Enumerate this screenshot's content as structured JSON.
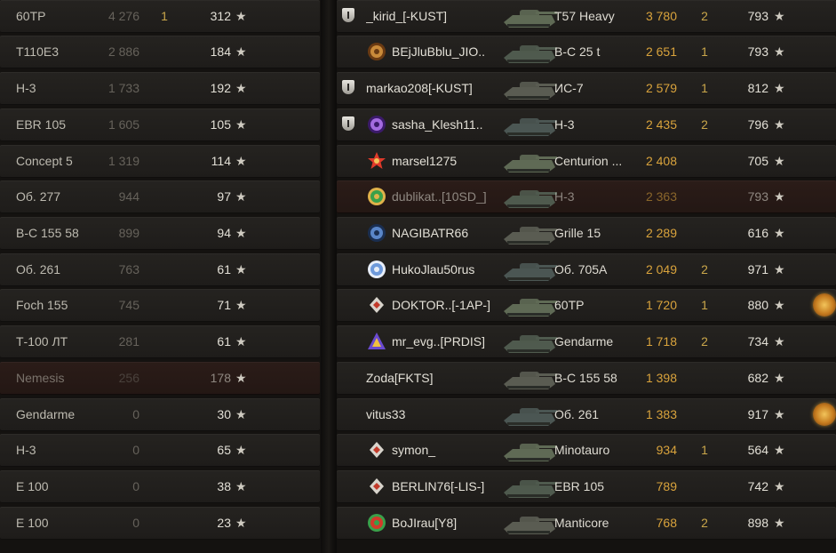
{
  "colors": {
    "gold": "#d9a33c",
    "kills": "#c9a64a",
    "dim": "#66625b",
    "text": "#e2dfd6",
    "dead_row": "#2b1c18"
  },
  "left_team": [
    {
      "tank": "60TP",
      "damage": "4 276",
      "kills": "1",
      "score": "312",
      "dead": false
    },
    {
      "tank": "T110E3",
      "damage": "2 886",
      "kills": "",
      "score": "184",
      "dead": false
    },
    {
      "tank": "Н-3",
      "damage": "1 733",
      "kills": "",
      "score": "192",
      "dead": false
    },
    {
      "tank": "EBR 105",
      "damage": "1 605",
      "kills": "",
      "score": "105",
      "dead": false
    },
    {
      "tank": "Concept 5",
      "damage": "1 319",
      "kills": "",
      "score": "114",
      "dead": false
    },
    {
      "tank": "Об. 277",
      "damage": "944",
      "kills": "",
      "score": "97",
      "dead": false
    },
    {
      "tank": "В-С 155 58",
      "damage": "899",
      "kills": "",
      "score": "94",
      "dead": false
    },
    {
      "tank": "Об. 261",
      "damage": "763",
      "kills": "",
      "score": "61",
      "dead": false
    },
    {
      "tank": "Foch 155",
      "damage": "745",
      "kills": "",
      "score": "71",
      "dead": false
    },
    {
      "tank": "Т-100 ЛТ",
      "damage": "281",
      "kills": "",
      "score": "61",
      "dead": false
    },
    {
      "tank": "Nemesis",
      "damage": "256",
      "kills": "",
      "score": "178",
      "dead": true
    },
    {
      "tank": "Gendarme",
      "damage": "0",
      "kills": "",
      "score": "30",
      "dead": false
    },
    {
      "tank": "Н-3",
      "damage": "0",
      "kills": "",
      "score": "65",
      "dead": false
    },
    {
      "tank": "E 100",
      "damage": "0",
      "kills": "",
      "score": "38",
      "dead": false
    },
    {
      "tank": "E 100",
      "damage": "0",
      "kills": "",
      "score": "23",
      "dead": false
    }
  ],
  "right_team": [
    {
      "name": "_kirid_[-KUST]",
      "badge": true,
      "icon": "",
      "tank": "T57 Heavy",
      "damage": "3 780",
      "kills": "2",
      "score": "793",
      "medal": false,
      "dead": false
    },
    {
      "name": "BEjJluBblu_JIO..",
      "badge": false,
      "icon": "bronze-rank-icon",
      "tank": "В-С 25 t",
      "damage": "2 651",
      "kills": "1",
      "score": "793",
      "medal": false,
      "dead": false
    },
    {
      "name": "markao208[-KUST]",
      "badge": true,
      "icon": "",
      "tank": "ИС-7",
      "damage": "2 579",
      "kills": "1",
      "score": "812",
      "medal": false,
      "dead": false
    },
    {
      "name": "sasha_Klesh11..",
      "badge": true,
      "icon": "purple-rank-icon",
      "tank": "Н-3",
      "damage": "2 435",
      "kills": "2",
      "score": "796",
      "medal": false,
      "dead": false
    },
    {
      "name": "marsel1275",
      "badge": false,
      "icon": "red-star-rank-icon",
      "tank": "Centurion ...",
      "damage": "2 408",
      "kills": "",
      "score": "705",
      "medal": false,
      "dead": false
    },
    {
      "name": "dublikat..[10SD_]",
      "badge": false,
      "icon": "green-rank-icon",
      "tank": "Н-3",
      "damage": "2 363",
      "kills": "",
      "score": "793",
      "medal": false,
      "dead": true
    },
    {
      "name": "NAGIBATR66",
      "badge": false,
      "icon": "blue-rank-icon",
      "tank": "Grille 15",
      "damage": "2 289",
      "kills": "",
      "score": "616",
      "medal": false,
      "dead": false
    },
    {
      "name": "HukoJlau50rus",
      "badge": false,
      "icon": "blue-round-rank-icon",
      "tank": "Об. 705А",
      "damage": "2 049",
      "kills": "2",
      "score": "971",
      "medal": false,
      "dead": false
    },
    {
      "name": "DOKTOR..[-1AP-]",
      "badge": false,
      "icon": "diamond-rank-icon",
      "tank": "60TP",
      "damage": "1 720",
      "kills": "1",
      "score": "880",
      "medal": true,
      "dead": false
    },
    {
      "name": "mr_evg..[PRDIS]",
      "badge": false,
      "icon": "purple-triangle-rank-icon",
      "tank": "Gendarme",
      "damage": "1 718",
      "kills": "2",
      "score": "734",
      "medal": false,
      "dead": false
    },
    {
      "name": "Zoda[FKTS]",
      "badge": false,
      "icon": "",
      "tank": "В-С 155 58",
      "damage": "1 398",
      "kills": "",
      "score": "682",
      "medal": false,
      "dead": false
    },
    {
      "name": "vitus33",
      "badge": false,
      "icon": "",
      "tank": "Об. 261",
      "damage": "1 383",
      "kills": "",
      "score": "917",
      "medal": true,
      "dead": false
    },
    {
      "name": "symon_",
      "badge": false,
      "icon": "diamond-rank-icon",
      "tank": "Minotauro",
      "damage": "934",
      "kills": "1",
      "score": "564",
      "medal": false,
      "dead": false
    },
    {
      "name": "BERLIN76[-LIS-]",
      "badge": false,
      "icon": "diamond-rank-icon",
      "tank": "EBR 105",
      "damage": "789",
      "kills": "",
      "score": "742",
      "medal": false,
      "dead": false
    },
    {
      "name": "BoJIrau[Y8]",
      "badge": false,
      "icon": "green-red-rank-icon",
      "tank": "Manticore",
      "damage": "768",
      "kills": "2",
      "score": "898",
      "medal": false,
      "dead": false
    }
  ],
  "star_glyph": "★"
}
